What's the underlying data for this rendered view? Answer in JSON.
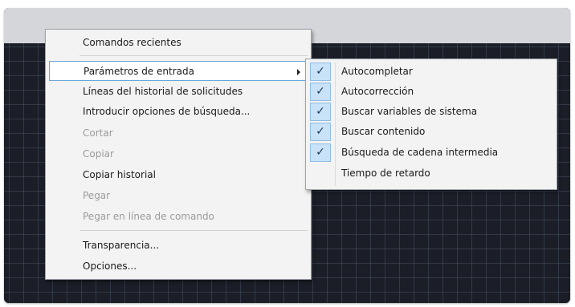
{
  "main_menu": {
    "items": [
      {
        "label": "Comandos recientes"
      },
      {
        "label": "Parámetros de entrada"
      },
      {
        "label": "Líneas del historial de solicitudes"
      },
      {
        "label": "Introducir opciones de búsqueda..."
      },
      {
        "label": "Cortar"
      },
      {
        "label": "Copiar"
      },
      {
        "label": "Copiar historial"
      },
      {
        "label": "Pegar"
      },
      {
        "label": "Pegar en línea de comando"
      },
      {
        "label": "Transparencia..."
      },
      {
        "label": "Opciones..."
      }
    ]
  },
  "sub_menu": {
    "check_glyph": "✓",
    "items": [
      {
        "label": "Autocompletar",
        "checked": true
      },
      {
        "label": "Autocorrección",
        "checked": true
      },
      {
        "label": "Buscar variables de sistema",
        "checked": true
      },
      {
        "label": "Buscar contenido",
        "checked": true
      },
      {
        "label": "Búsqueda de cadena intermedia",
        "checked": true
      },
      {
        "label": "Tiempo de retardo",
        "checked": false
      }
    ]
  },
  "colors": {
    "canvas": "#1b1e27",
    "titlebar": "#d5d6da",
    "menu_bg": "#f3f3f3",
    "highlight_border": "#6aa6d8",
    "check_bg": "#c9e2f7",
    "disabled_text": "#9b9b9b"
  }
}
